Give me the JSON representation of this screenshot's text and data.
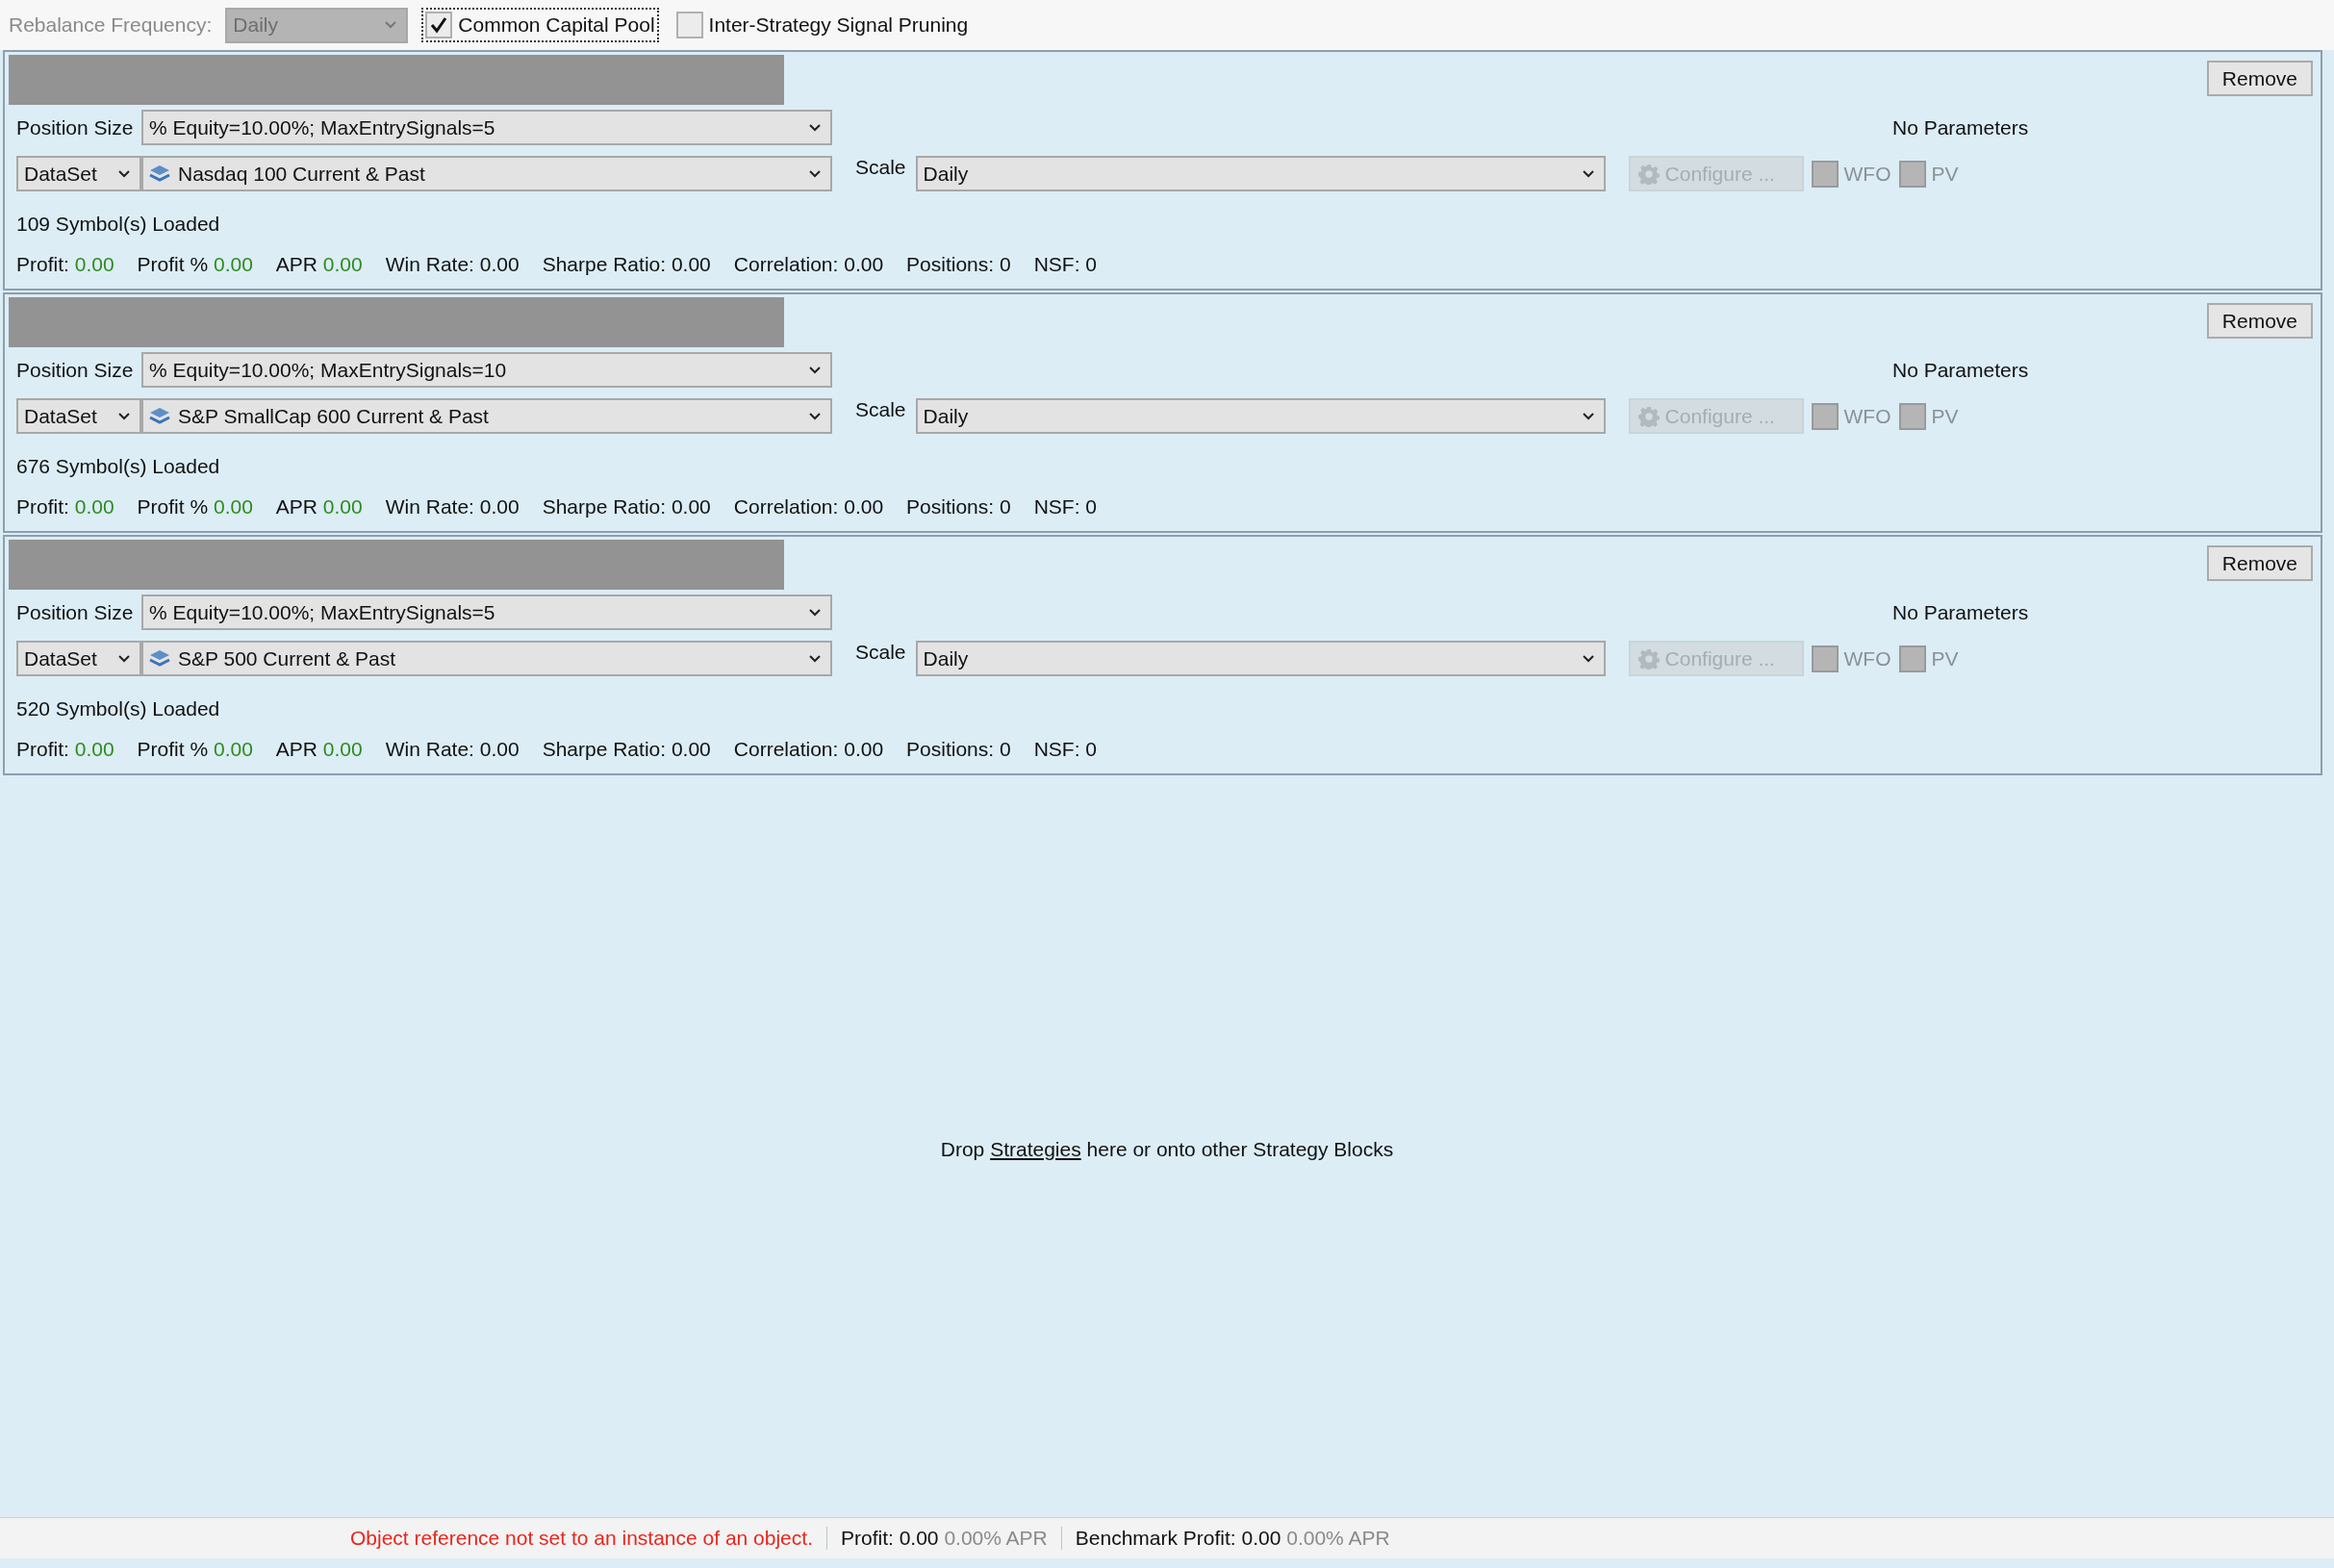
{
  "toolbar": {
    "rebalance_label": "Rebalance Frequency:",
    "rebalance_value": "Daily",
    "rebalance_disabled": true,
    "options": [
      {
        "label": "Common Capital Pool",
        "checked": true,
        "focused": true
      },
      {
        "label": "Inter-Strategy Signal Pruning",
        "checked": false,
        "focused": false
      }
    ]
  },
  "blocks": [
    {
      "remove": "Remove",
      "position_size_label": "Position Size",
      "position_size": "% Equity=10.00%; MaxEntrySignals=5",
      "parameters_note": "No Parameters",
      "source_type": "DataSet",
      "dataset": "Nasdaq 100 Current & Past",
      "scale_label": "Scale",
      "scale": "Daily",
      "configure": "Configure ...",
      "configure_disabled": true,
      "toggles": [
        {
          "label": "WFO",
          "checked": false
        },
        {
          "label": "PV",
          "checked": false
        }
      ],
      "symbols_loaded": "109 Symbol(s) Loaded",
      "stats": [
        {
          "label": "Profit:",
          "value": "0.00",
          "kind": "gain"
        },
        {
          "label": "Profit %",
          "value": "0.00",
          "kind": "gain"
        },
        {
          "label": "APR",
          "value": "0.00",
          "kind": "gain"
        },
        {
          "label": "Win Rate:",
          "value": "0.00",
          "kind": "plain"
        },
        {
          "label": "Sharpe Ratio:",
          "value": "0.00",
          "kind": "plain"
        },
        {
          "label": "Correlation:",
          "value": "0.00",
          "kind": "plain"
        },
        {
          "label": "Positions:",
          "value": "0",
          "kind": "plain"
        },
        {
          "label": "NSF:",
          "value": "0",
          "kind": "plain"
        }
      ]
    },
    {
      "remove": "Remove",
      "position_size_label": "Position Size",
      "position_size": "% Equity=10.00%; MaxEntrySignals=10",
      "parameters_note": "No Parameters",
      "source_type": "DataSet",
      "dataset": "S&P SmallCap 600 Current & Past",
      "scale_label": "Scale",
      "scale": "Daily",
      "configure": "Configure ...",
      "configure_disabled": true,
      "toggles": [
        {
          "label": "WFO",
          "checked": false
        },
        {
          "label": "PV",
          "checked": false
        }
      ],
      "symbols_loaded": "676 Symbol(s) Loaded",
      "stats": [
        {
          "label": "Profit:",
          "value": "0.00",
          "kind": "gain"
        },
        {
          "label": "Profit %",
          "value": "0.00",
          "kind": "gain"
        },
        {
          "label": "APR",
          "value": "0.00",
          "kind": "gain"
        },
        {
          "label": "Win Rate:",
          "value": "0.00",
          "kind": "plain"
        },
        {
          "label": "Sharpe Ratio:",
          "value": "0.00",
          "kind": "plain"
        },
        {
          "label": "Correlation:",
          "value": "0.00",
          "kind": "plain"
        },
        {
          "label": "Positions:",
          "value": "0",
          "kind": "plain"
        },
        {
          "label": "NSF:",
          "value": "0",
          "kind": "plain"
        }
      ]
    },
    {
      "remove": "Remove",
      "position_size_label": "Position Size",
      "position_size": "% Equity=10.00%; MaxEntrySignals=5",
      "parameters_note": "No Parameters",
      "source_type": "DataSet",
      "dataset": "S&P 500 Current & Past",
      "scale_label": "Scale",
      "scale": "Daily",
      "configure": "Configure ...",
      "configure_disabled": true,
      "toggles": [
        {
          "label": "WFO",
          "checked": false
        },
        {
          "label": "PV",
          "checked": false
        }
      ],
      "symbols_loaded": "520 Symbol(s) Loaded",
      "stats": [
        {
          "label": "Profit:",
          "value": "0.00",
          "kind": "gain"
        },
        {
          "label": "Profit %",
          "value": "0.00",
          "kind": "gain"
        },
        {
          "label": "APR",
          "value": "0.00",
          "kind": "gain"
        },
        {
          "label": "Win Rate:",
          "value": "0.00",
          "kind": "plain"
        },
        {
          "label": "Sharpe Ratio:",
          "value": "0.00",
          "kind": "plain"
        },
        {
          "label": "Correlation:",
          "value": "0.00",
          "kind": "plain"
        },
        {
          "label": "Positions:",
          "value": "0",
          "kind": "plain"
        },
        {
          "label": "NSF:",
          "value": "0",
          "kind": "plain"
        }
      ]
    }
  ],
  "drop_hint": {
    "before": "Drop",
    "link": "Strategies",
    "after": "here or onto other Strategy Blocks"
  },
  "status_bar": {
    "message": "Object reference not set to an instance of an object.",
    "profit": "Profit: 0.00",
    "profit_apr": "0.00% APR",
    "benchmark": "Benchmark Profit: 0.00",
    "benchmark_apr": "0.00% APR"
  }
}
